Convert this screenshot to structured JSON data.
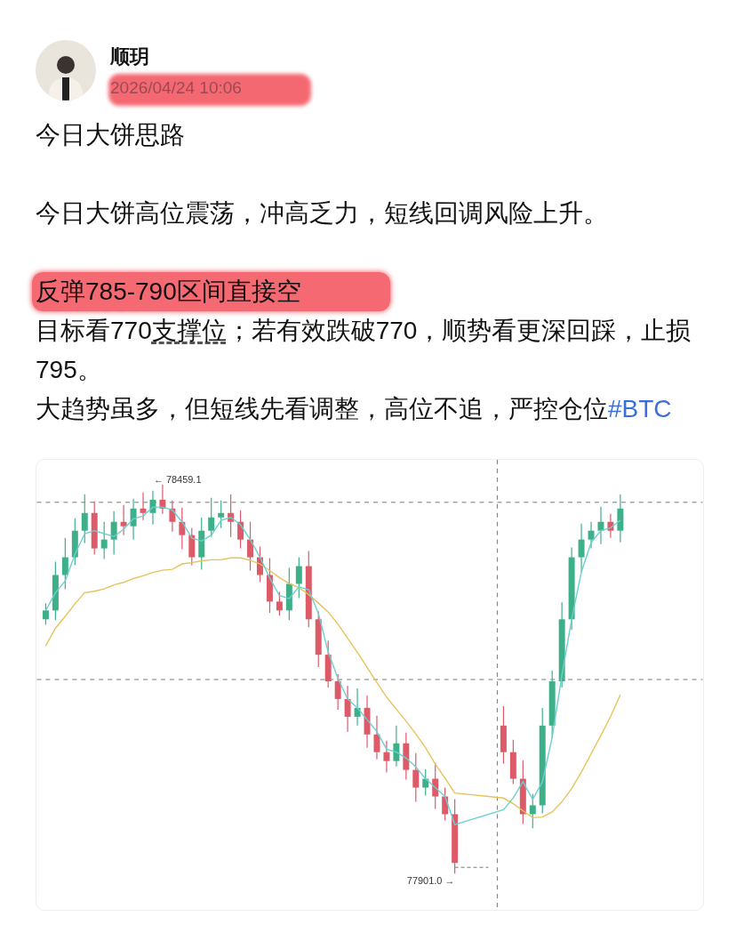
{
  "post": {
    "author": "顺玥",
    "date": {
      "text": "2026/04/24 10:06",
      "highlighted": true
    },
    "blocks": [
      {
        "paragraphs": [
          {
            "segments": [
              {
                "kind": "plain",
                "text": "今日大饼思路"
              }
            ],
            "highlighted": false
          }
        ]
      },
      {
        "paragraphs": [
          {
            "segments": [
              {
                "kind": "plain",
                "text": "今日大饼高位震荡，冲高乏力，短线回调风险上升。"
              }
            ],
            "highlighted": false
          }
        ]
      },
      {
        "paragraphs": [
          {
            "segments": [
              {
                "kind": "plain",
                "text": "反弹785-790区间直接空"
              }
            ],
            "highlighted": true
          },
          {
            "segments": [
              {
                "kind": "plain",
                "text": "目标看770"
              },
              {
                "kind": "term",
                "text": "支撑位"
              },
              {
                "kind": "plain",
                "text": "；若有效跌破770，顺势看更深回踩，止损795。"
              }
            ],
            "highlighted": false
          },
          {
            "segments": [
              {
                "kind": "plain",
                "text": "大趋势虽多，但短线先看调整，高位不追，严控仓位"
              },
              {
                "kind": "hashtag",
                "text": "#BTC"
              }
            ],
            "highlighted": false
          }
        ]
      }
    ],
    "chart": {
      "high_label": "← 78459.1",
      "low_label": "77901.0 →"
    }
  }
}
